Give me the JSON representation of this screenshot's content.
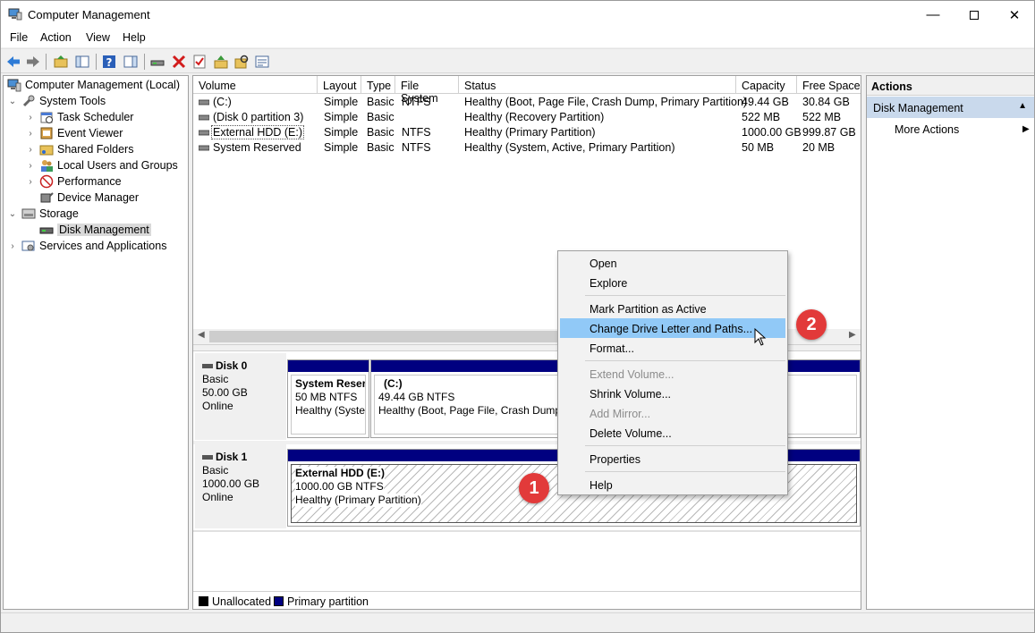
{
  "window": {
    "title": "Computer Management"
  },
  "menu": [
    "File",
    "Action",
    "View",
    "Help"
  ],
  "tree": {
    "root": "Computer Management (Local)",
    "system_tools": "System Tools",
    "task_scheduler": "Task Scheduler",
    "event_viewer": "Event Viewer",
    "shared_folders": "Shared Folders",
    "local_users": "Local Users and Groups",
    "performance": "Performance",
    "device_manager": "Device Manager",
    "storage": "Storage",
    "disk_management": "Disk Management",
    "services": "Services and Applications"
  },
  "volume_table": {
    "columns": [
      "Volume",
      "Layout",
      "Type",
      "File System",
      "Status",
      "Capacity",
      "Free Space"
    ],
    "rows": [
      [
        "(C:)",
        "Simple",
        "Basic",
        "NTFS",
        "Healthy (Boot, Page File, Crash Dump, Primary Partition)",
        "49.44 GB",
        "30.84 GB"
      ],
      [
        "(Disk 0 partition 3)",
        "Simple",
        "Basic",
        "",
        "Healthy (Recovery Partition)",
        "522 MB",
        "522 MB"
      ],
      [
        "External HDD (E:)",
        "Simple",
        "Basic",
        "NTFS",
        "Healthy (Primary Partition)",
        "1000.00 GB",
        "999.87 GB"
      ],
      [
        "System Reserved",
        "Simple",
        "Basic",
        "NTFS",
        "Healthy (System, Active, Primary Partition)",
        "50 MB",
        "20 MB"
      ]
    ]
  },
  "disks": {
    "disk0": {
      "name": "Disk 0",
      "type": "Basic",
      "size": "50.00 GB",
      "state": "Online",
      "p1": {
        "name": "System Reser",
        "size": "50 MB NTFS",
        "status": "Healthy (Syster"
      },
      "p2": {
        "name": "(C:)",
        "size": "49.44 GB NTFS",
        "status": "Healthy (Boot, Page File, Crash Dump,"
      }
    },
    "disk1": {
      "name": "Disk 1",
      "type": "Basic",
      "size": "1000.00 GB",
      "state": "Online",
      "p1": {
        "name": "External HDD  (E:)",
        "size": "1000.00 GB NTFS",
        "status": "Healthy (Primary Partition)"
      }
    }
  },
  "legend": {
    "unallocated": "Unallocated",
    "primary": "Primary partition"
  },
  "actions": {
    "header": "Actions",
    "section": "Disk Management",
    "more": "More Actions"
  },
  "context_menu": {
    "open": "Open",
    "explore": "Explore",
    "mark_active": "Mark Partition as Active",
    "change_letter": "Change Drive Letter and Paths...",
    "format": "Format...",
    "extend": "Extend Volume...",
    "shrink": "Shrink Volume...",
    "add_mirror": "Add Mirror...",
    "delete": "Delete Volume...",
    "properties": "Properties",
    "help": "Help"
  },
  "badges": {
    "one": "1",
    "two": "2"
  },
  "colors": {
    "primary_partition": "#000080",
    "hover": "#91c9f7",
    "badge": "#e23a3a",
    "selected_section": "#c9d9ec"
  }
}
